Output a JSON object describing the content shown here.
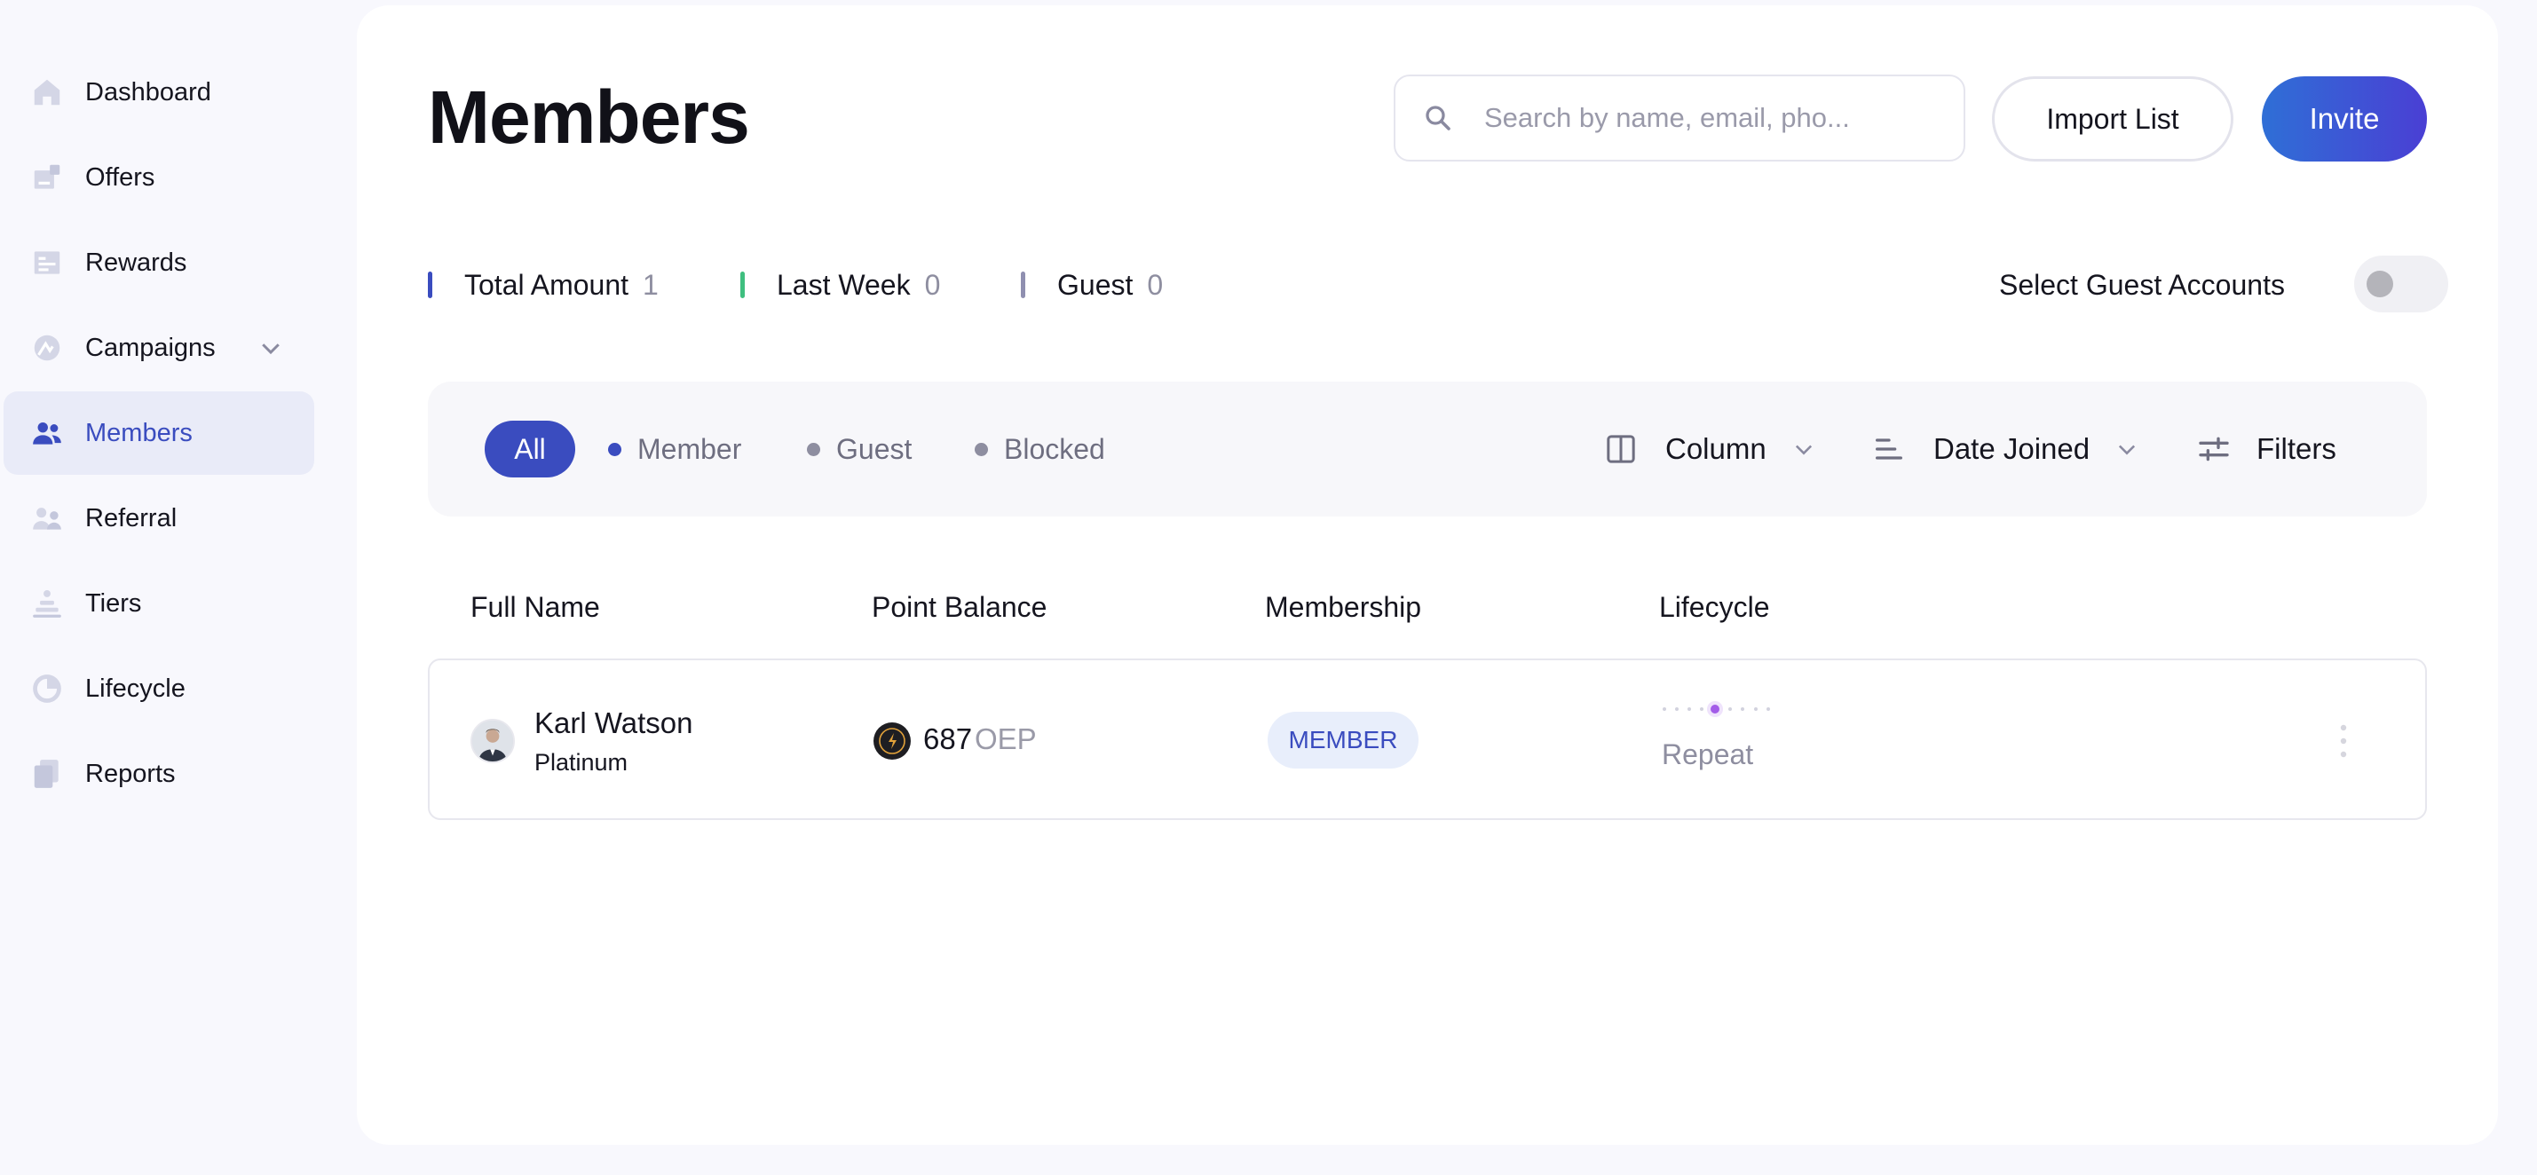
{
  "sidebar": {
    "items": [
      {
        "label": "Dashboard",
        "icon": "home-icon"
      },
      {
        "label": "Offers",
        "icon": "offers-icon"
      },
      {
        "label": "Rewards",
        "icon": "rewards-icon"
      },
      {
        "label": "Campaigns",
        "icon": "campaigns-icon"
      },
      {
        "label": "Members",
        "icon": "members-icon",
        "active": true
      },
      {
        "label": "Referral",
        "icon": "referral-icon"
      },
      {
        "label": "Tiers",
        "icon": "tiers-icon"
      },
      {
        "label": "Lifecycle",
        "icon": "lifecycle-icon"
      },
      {
        "label": "Reports",
        "icon": "reports-icon"
      }
    ]
  },
  "header": {
    "title": "Members",
    "search_placeholder": "Search by name, email, pho...",
    "import_label": "Import List",
    "invite_label": "Invite"
  },
  "stats": [
    {
      "label": "Total Amount",
      "value": "1",
      "color": "#3a4cbf"
    },
    {
      "label": "Last Week",
      "value": "0",
      "color": "#3fbf7f"
    },
    {
      "label": "Guest",
      "value": "0",
      "color": "#8f8fb0"
    }
  ],
  "guest_toggle": {
    "label": "Select Guest Accounts",
    "on": false
  },
  "filters": {
    "all_label": "All",
    "chips": [
      {
        "label": "Member",
        "color": "#3a4cbf"
      },
      {
        "label": "Guest",
        "color": "#8e8ea0"
      },
      {
        "label": "Blocked",
        "color": "#8e8ea0"
      }
    ],
    "column_label": "Column",
    "sort_label": "Date Joined",
    "filters_label": "Filters"
  },
  "table": {
    "headers": [
      "Full Name",
      "Point Balance",
      "Membership",
      "Lifecycle"
    ],
    "rows": [
      {
        "name": "Karl Watson",
        "tier": "Platinum",
        "points": "687",
        "points_unit": "OEP",
        "membership": "MEMBER",
        "lifecycle": "Repeat"
      }
    ]
  },
  "colors": {
    "accent": "#3a4cbf",
    "invite_gradient_start": "#2f6fd6",
    "invite_gradient_end": "#4a3fd4"
  }
}
